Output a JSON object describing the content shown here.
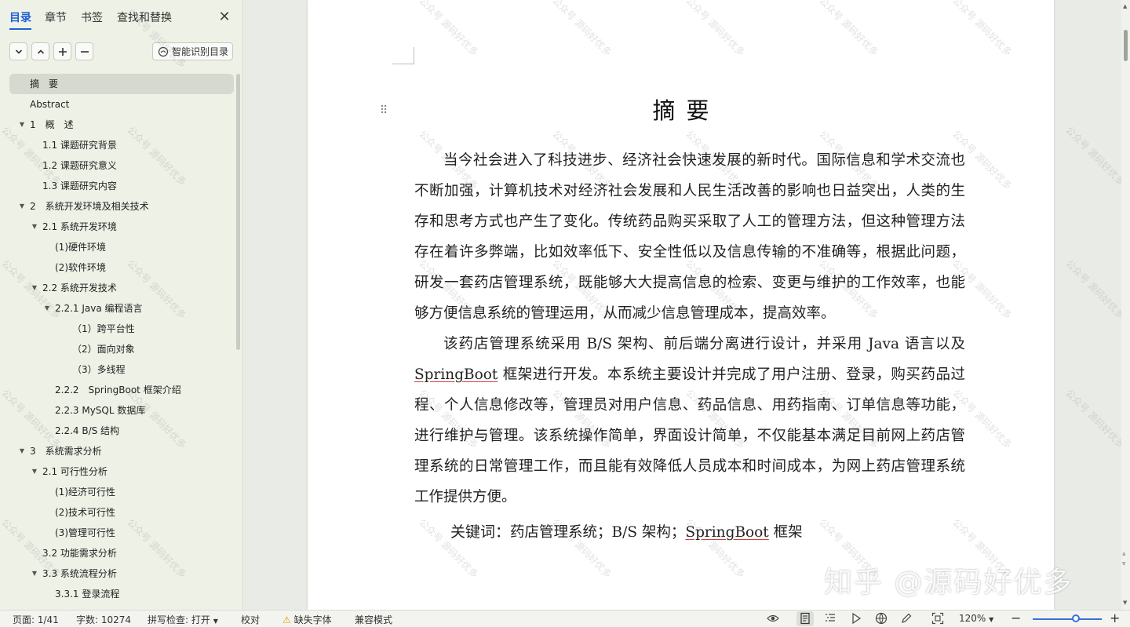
{
  "sidebar": {
    "tabs": [
      {
        "label": "目录",
        "active": true
      },
      {
        "label": "章节",
        "active": false
      },
      {
        "label": "书签",
        "active": false
      },
      {
        "label": "查找和替换",
        "active": false
      }
    ],
    "close_icon": "close-icon",
    "toolbar": {
      "expand_icon": "chevron-down-icon",
      "collapse_icon": "chevron-up-icon",
      "add_icon": "plus-icon",
      "remove_icon": "minus-icon",
      "smart_label": "智能识别目录"
    },
    "toc": [
      {
        "label": "摘　要",
        "level": 0,
        "arrow": "",
        "selected": true
      },
      {
        "label": "Abstract",
        "level": 0,
        "arrow": ""
      },
      {
        "label": "1　概　述",
        "level": 0,
        "arrow": "▼"
      },
      {
        "label": "1.1  课题研究背景",
        "level": 1,
        "arrow": ""
      },
      {
        "label": "1.2  课题研究意义",
        "level": 1,
        "arrow": ""
      },
      {
        "label": "1.3  课题研究内容",
        "level": 1,
        "arrow": ""
      },
      {
        "label": "2　系统开发环境及相关技术",
        "level": 0,
        "arrow": "▼"
      },
      {
        "label": "2.1  系统开发环境",
        "level": 1,
        "arrow": "▼"
      },
      {
        "label": "(1)硬件环境",
        "level": 2,
        "arrow": ""
      },
      {
        "label": "(2)软件环境",
        "level": 2,
        "arrow": ""
      },
      {
        "label": "2.2  系统开发技术",
        "level": 1,
        "arrow": "▼"
      },
      {
        "label": "2.2.1 Java 编程语言",
        "level": 2,
        "arrow": "▼"
      },
      {
        "label": "（1）跨平台性",
        "level": 3,
        "arrow": ""
      },
      {
        "label": "（2）面向对象",
        "level": 3,
        "arrow": ""
      },
      {
        "label": "（3）多线程",
        "level": 3,
        "arrow": ""
      },
      {
        "label": "2.2.2　SpringBoot 框架介绍",
        "level": 2,
        "arrow": ""
      },
      {
        "label": "2.2.3 MySQL 数据库",
        "level": 2,
        "arrow": ""
      },
      {
        "label": "2.2.4 B/S 结构",
        "level": 2,
        "arrow": ""
      },
      {
        "label": "3　系统需求分析",
        "level": 0,
        "arrow": "▼"
      },
      {
        "label": "2.1  可行性分析",
        "level": 1,
        "arrow": "▼"
      },
      {
        "label": "(1)经济可行性",
        "level": 2,
        "arrow": ""
      },
      {
        "label": "(2)技术可行性",
        "level": 2,
        "arrow": ""
      },
      {
        "label": "(3)管理可行性",
        "level": 2,
        "arrow": ""
      },
      {
        "label": "3.2  功能需求分析",
        "level": 1,
        "arrow": ""
      },
      {
        "label": "3.3  系统流程分析",
        "level": 1,
        "arrow": "▼"
      },
      {
        "label": "3.3.1  登录流程",
        "level": 2,
        "arrow": ""
      }
    ]
  },
  "document": {
    "title": "摘要",
    "para1": "当今社会进入了科技进步、经济社会快速发展的新时代。国际信息和学术交流也不断加强，计算机技术对经济社会发展和人民生活改善的影响也日益突出，人类的生存和思考方式也产生了变化。传统药品购买采取了人工的管理方法，但这种管理方法存在着许多弊端，比如效率低下、安全性低以及信息传输的不准确等，根据此问题，研发一套药店管理系统，既能够大大提高信息的检索、变更与维护的工作效率，也能够方便信息系统的管理运用，从而减少信息管理成本，提高效率。",
    "para2_start": "该药店管理系统采用 B/S 架构、前后端分离进行设计，并采用 Java 语言以及 ",
    "para2_link": "SpringBoot",
    "para2_end": " 框架进行开发。本系统主要设计并完成了用户注册、登录，购买药品过程、个人信息修改等，管理员对用户信息、药品信息、用药指南、订单信息等功能，进行维护与管理。该系统操作简单，界面设计简单，不仅能基本满足目前网上药店管理系统的日常管理工作，而且能有效降低人员成本和时间成本，为网上药店管理系统工作提供方便。",
    "keywords_label": "关键词：",
    "keywords_start": "药店管理系统；B/S  架构；",
    "keywords_link": "SpringBoot",
    "keywords_end": " 框架",
    "watermark_text": "公众号 源码好优多",
    "brand_watermark": "知乎 @源码好优多"
  },
  "status_bar": {
    "page": "页面: 1/41",
    "words": "字数: 10274",
    "spell": "拼写检查: 打开",
    "proofread": "校对",
    "missing_font": "缺失字体",
    "compat": "兼容模式",
    "zoom": "120%"
  },
  "colors": {
    "accent": "#1d5fd6",
    "sidebar_bg": "#eef1e6",
    "page_bg": "#ffffff"
  }
}
